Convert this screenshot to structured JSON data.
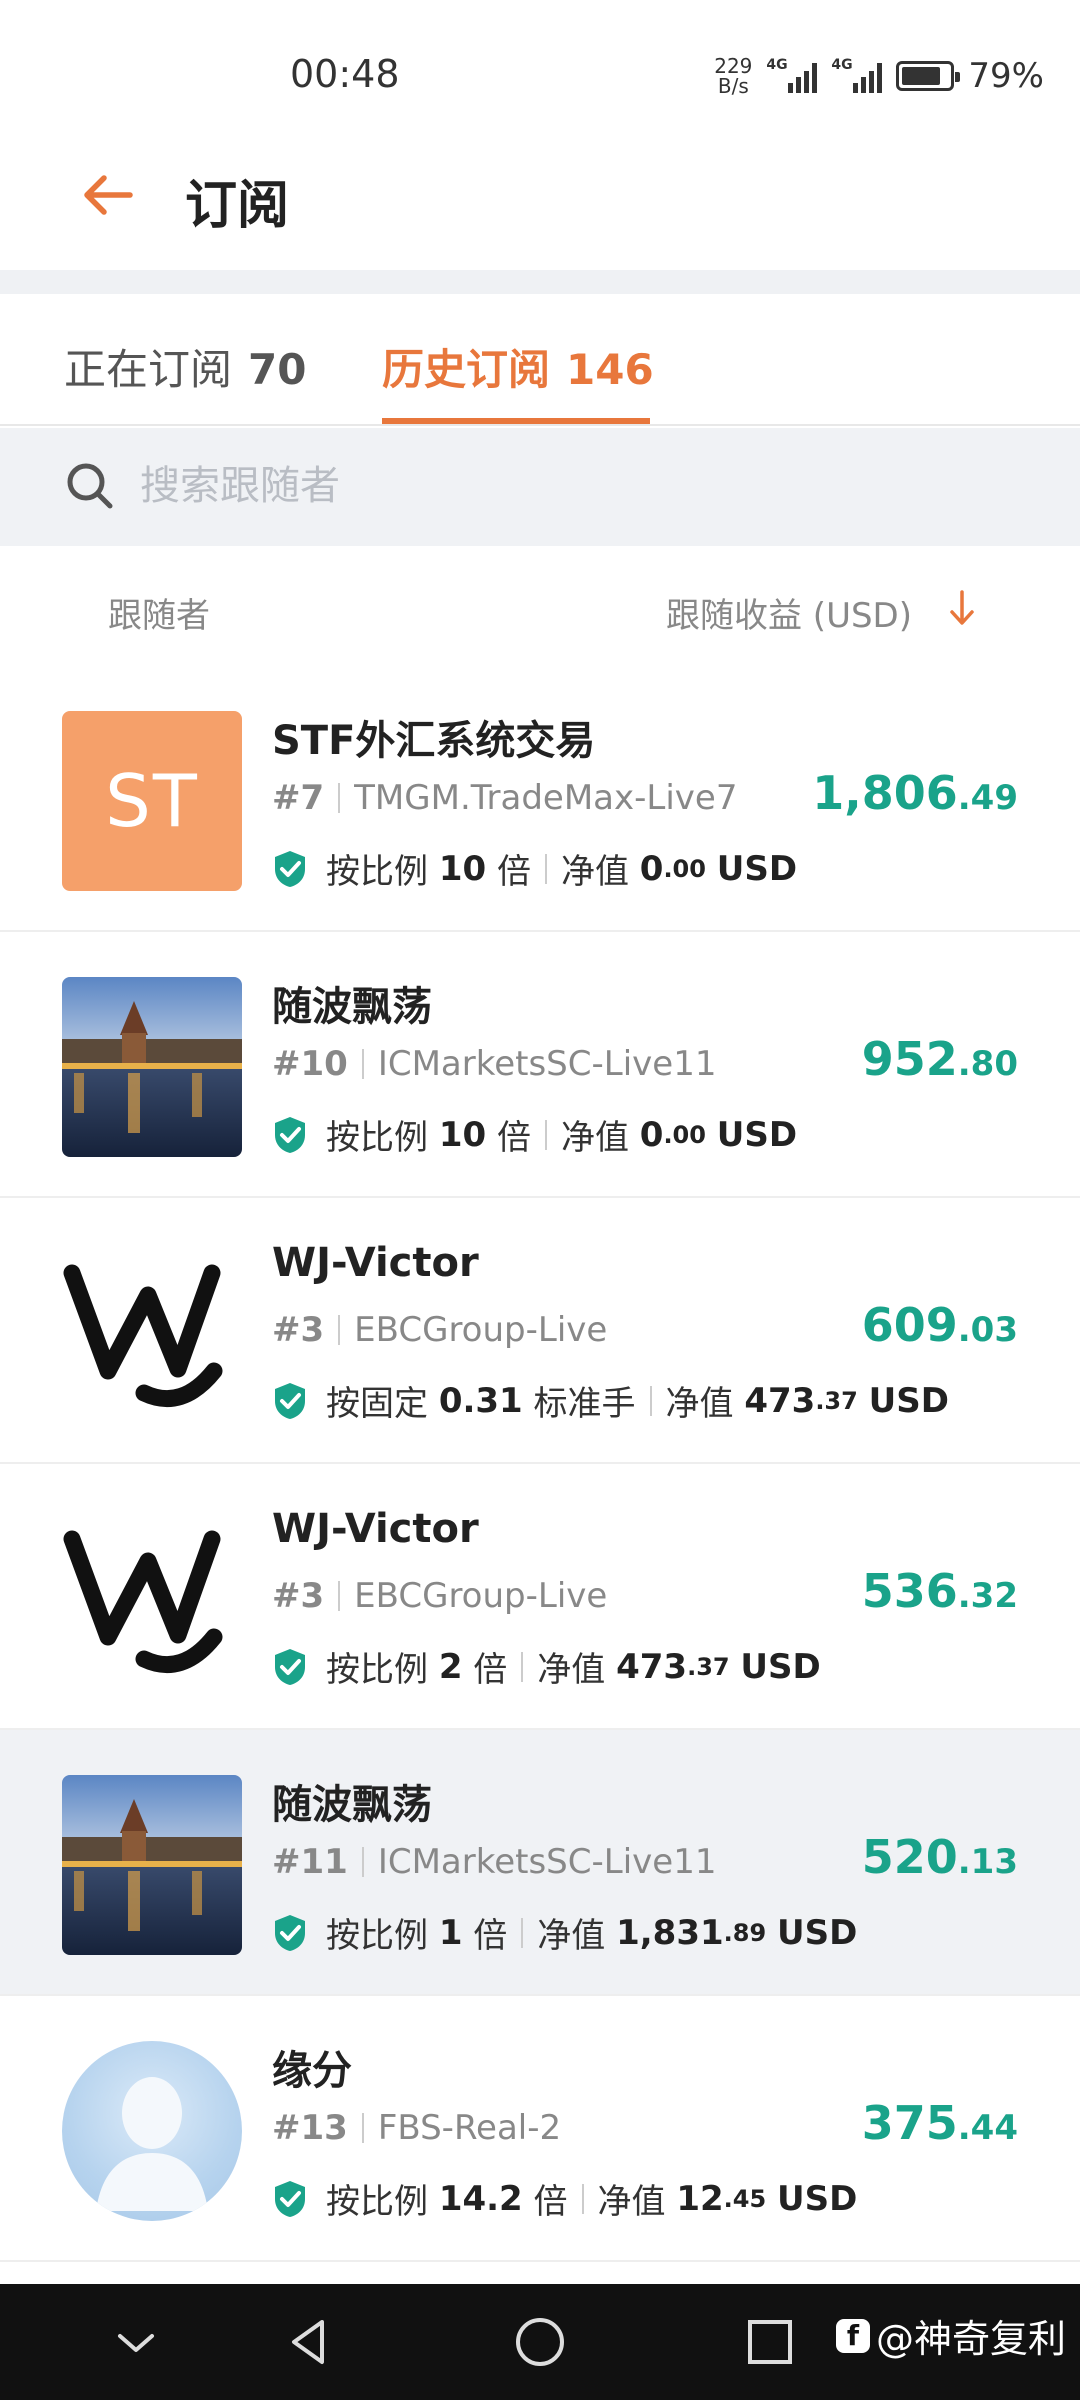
{
  "status": {
    "time": "00:48",
    "net_speed_value": "229",
    "net_speed_unit": "B/s",
    "signal1_label": "4G",
    "signal2_label": "4G",
    "battery": "79%"
  },
  "header": {
    "title": "订阅",
    "back_icon": "arrow-left-icon"
  },
  "tabs": [
    {
      "label": "正在订阅",
      "count": "70",
      "active": false
    },
    {
      "label": "历史订阅",
      "count": "146",
      "active": true
    }
  ],
  "search": {
    "placeholder": "搜索跟随者"
  },
  "columns": {
    "follower": "跟随者",
    "profit": "跟随收益 (USD)"
  },
  "colors": {
    "accent": "#e8773c",
    "profit": "#1aa38a",
    "shield": "#1aa38a"
  },
  "rows": [
    {
      "name": "STF外汇系统交易",
      "avatar_text": "ST",
      "rank": "#7",
      "account": "TMGM.TradeMax-Live7",
      "mode_prefix": "按比例",
      "mode_value": "10",
      "mode_suffix": "倍",
      "equity_label": "净值",
      "equity_int": "0",
      "equity_dec": ".00",
      "equity_unit": "USD",
      "profit_int": "1,806",
      "profit_dec": ".49"
    },
    {
      "name": "随波飘荡",
      "rank": "#10",
      "account": "ICMarketsSC-Live11",
      "mode_prefix": "按比例",
      "mode_value": "10",
      "mode_suffix": "倍",
      "equity_label": "净值",
      "equity_int": "0",
      "equity_dec": ".00",
      "equity_unit": "USD",
      "profit_int": "952",
      "profit_dec": ".80"
    },
    {
      "name": "WJ-Victor",
      "rank": "#3",
      "account": "EBCGroup-Live",
      "mode_prefix": "按固定",
      "mode_value": "0.31",
      "mode_suffix": "标准手",
      "equity_label": "净值",
      "equity_int": "473",
      "equity_dec": ".37",
      "equity_unit": "USD",
      "profit_int": "609",
      "profit_dec": ".03"
    },
    {
      "name": "WJ-Victor",
      "rank": "#3",
      "account": "EBCGroup-Live",
      "mode_prefix": "按比例",
      "mode_value": "2",
      "mode_suffix": "倍",
      "equity_label": "净值",
      "equity_int": "473",
      "equity_dec": ".37",
      "equity_unit": "USD",
      "profit_int": "536",
      "profit_dec": ".32"
    },
    {
      "name": "随波飘荡",
      "rank": "#11",
      "account": "ICMarketsSC-Live11",
      "mode_prefix": "按比例",
      "mode_value": "1",
      "mode_suffix": "倍",
      "equity_label": "净值",
      "equity_int": "1,831",
      "equity_dec": ".89",
      "equity_unit": "USD",
      "profit_int": "520",
      "profit_dec": ".13"
    },
    {
      "name": "缘分",
      "rank": "#13",
      "account": "FBS-Real-2",
      "mode_prefix": "按比例",
      "mode_value": "14.2",
      "mode_suffix": "倍",
      "equity_label": "净值",
      "equity_int": "12",
      "equity_dec": ".45",
      "equity_unit": "USD",
      "profit_int": "375",
      "profit_dec": ".44"
    }
  ],
  "watermark": "@神奇复利"
}
